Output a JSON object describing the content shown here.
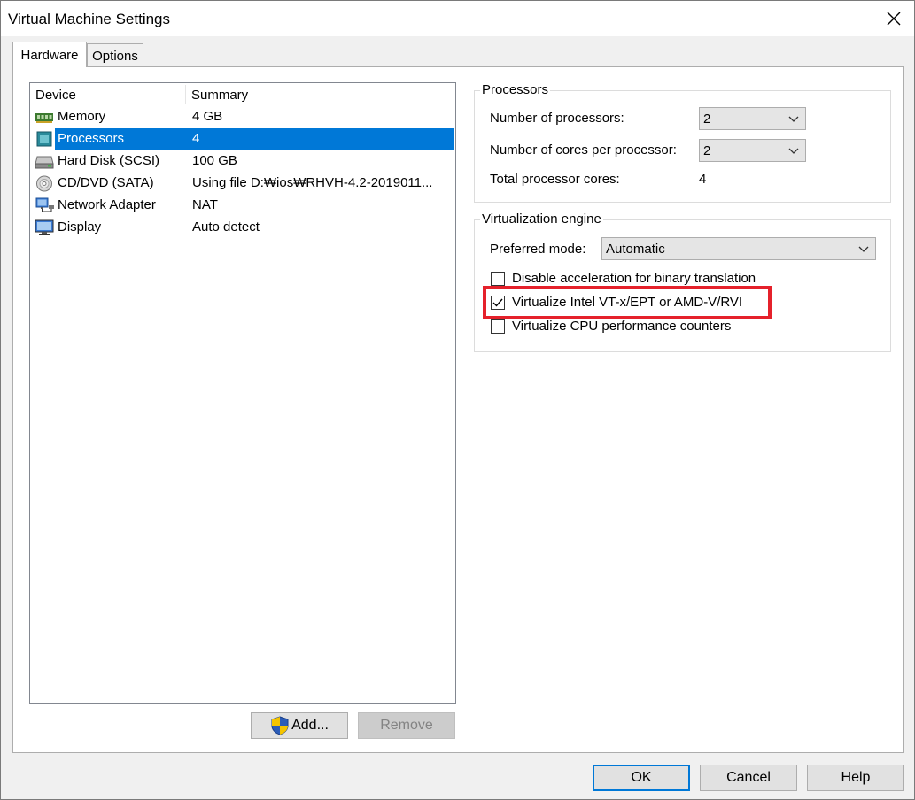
{
  "window": {
    "title": "Virtual Machine Settings"
  },
  "tabs": [
    {
      "label": "Hardware",
      "active": true
    },
    {
      "label": "Options",
      "active": false
    }
  ],
  "device_list": {
    "columns": [
      "Device",
      "Summary"
    ],
    "rows": [
      {
        "icon": "memory-icon",
        "name": "Memory",
        "summary": "4 GB"
      },
      {
        "icon": "processor-icon",
        "name": "Processors",
        "summary": "4",
        "selected": true
      },
      {
        "icon": "hard-disk-icon",
        "name": "Hard Disk (SCSI)",
        "summary": "100 GB"
      },
      {
        "icon": "cd-dvd-icon",
        "name": "CD/DVD (SATA)",
        "summary": "Using file D:₩ios₩RHVH-4.2-2019011..."
      },
      {
        "icon": "network-adapter-icon",
        "name": "Network Adapter",
        "summary": "NAT"
      },
      {
        "icon": "display-icon",
        "name": "Display",
        "summary": "Auto detect"
      }
    ]
  },
  "list_buttons": {
    "add_label": "Add...",
    "remove_label": "Remove"
  },
  "processors_group": {
    "title": "Processors",
    "num_processors_label": "Number of processors:",
    "num_processors_value": "2",
    "cores_label": "Number of cores per processor:",
    "cores_value": "2",
    "total_label": "Total processor cores:",
    "total_value": "4"
  },
  "virtualization_group": {
    "title": "Virtualization engine",
    "mode_label": "Preferred mode:",
    "mode_value": "Automatic",
    "options": [
      {
        "label": "Disable acceleration for binary translation",
        "checked": false
      },
      {
        "label": "Virtualize Intel VT-x/EPT or AMD-V/RVI",
        "checked": true
      },
      {
        "label": "Virtualize CPU performance counters",
        "checked": false
      }
    ]
  },
  "footer": {
    "ok_label": "OK",
    "cancel_label": "Cancel",
    "help_label": "Help"
  },
  "colors": {
    "selection": "#0078d7",
    "highlight": "#e5212b",
    "shield_blue": "#2b5cb8",
    "shield_yellow": "#f5c400"
  }
}
